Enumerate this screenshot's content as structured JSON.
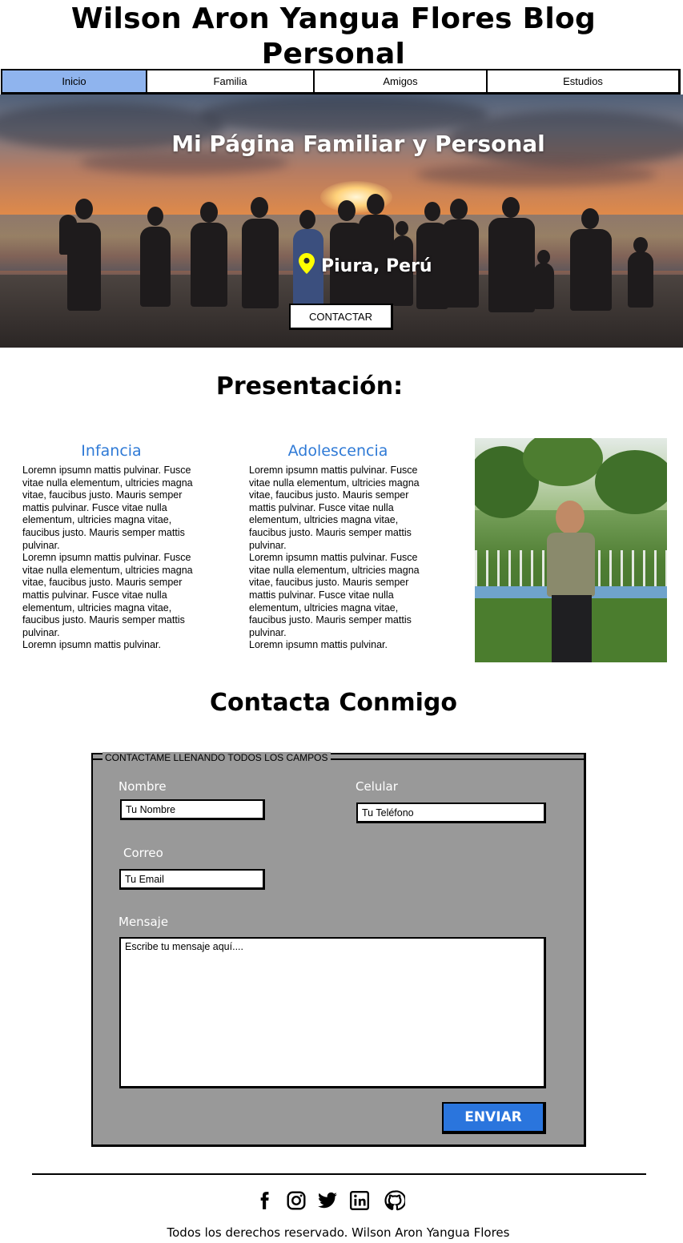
{
  "header": {
    "title": "Wilson Aron Yangua Flores Blog Personal"
  },
  "nav": {
    "items": [
      {
        "label": "Inicio",
        "active": true
      },
      {
        "label": "Familia",
        "active": false
      },
      {
        "label": "Amigos",
        "active": false
      },
      {
        "label": "Estudios",
        "active": false
      }
    ],
    "active_color": "#8fb4ee"
  },
  "hero": {
    "title": "Mi Página Familiar y Personal",
    "location": "Piura, Perú",
    "location_icon": "map-pin-icon",
    "location_icon_color": "#ffff00",
    "button_label": "CONTACTAR"
  },
  "presentation": {
    "title": "Presentación:",
    "columns": [
      {
        "title": "Infancia",
        "text": "Loremn ipsumn mattis pulvinar. Fusce vitae nulla elementum, ultricies magna vitae, faucibus justo. Mauris semper mattis pulvinar. Fusce vitae nulla elementum, ultricies magna vitae, faucibus justo. Mauris semper mattis pulvinar.\nLoremn ipsumn mattis pulvinar. Fusce vitae nulla elementum, ultricies magna vitae, faucibus justo. Mauris semper mattis pulvinar. Fusce vitae nulla elementum, ultricies magna vitae, faucibus justo. Mauris semper mattis pulvinar.\nLoremn ipsumn mattis pulvinar."
      },
      {
        "title": "Adolescencia",
        "text": "Loremn ipsumn mattis pulvinar. Fusce vitae nulla elementum, ultricies magna vitae, faucibus justo. Mauris semper mattis pulvinar. Fusce vitae nulla elementum, ultricies magna vitae, faucibus justo. Mauris semper mattis pulvinar.\nLoremn ipsumn mattis pulvinar. Fusce vitae nulla elementum, ultricies magna vitae, faucibus justo. Mauris semper mattis pulvinar. Fusce vitae nulla elementum, ultricies magna vitae, faucibus justo. Mauris semper mattis pulvinar.\nLoremn ipsumn mattis pulvinar."
      }
    ],
    "title_color": "#2f7ad6"
  },
  "contact": {
    "title": "Contacta Conmigo",
    "legend": "CONTACTAME LLENANDO TODOS LOS CAMPOS",
    "fields": {
      "name": {
        "label": "Nombre",
        "placeholder": "Tu Nombre",
        "value": ""
      },
      "phone": {
        "label": "Celular",
        "placeholder": "Tu Teléfono",
        "value": ""
      },
      "email": {
        "label": "Correo",
        "placeholder": "Tu Email",
        "value": ""
      },
      "message": {
        "label": "Mensaje",
        "placeholder": "Escribe tu mensaje aquí....",
        "value": ""
      }
    },
    "submit_label": "ENVIAR",
    "form_bg": "#999999",
    "submit_color": "#2a75dd"
  },
  "footer": {
    "social_icons": [
      "facebook-icon",
      "instagram-icon",
      "twitter-icon",
      "linkedin-icon",
      "github-icon"
    ],
    "copyright": "Todos los derechos reservado. Wilson Aron Yangua Flores"
  }
}
